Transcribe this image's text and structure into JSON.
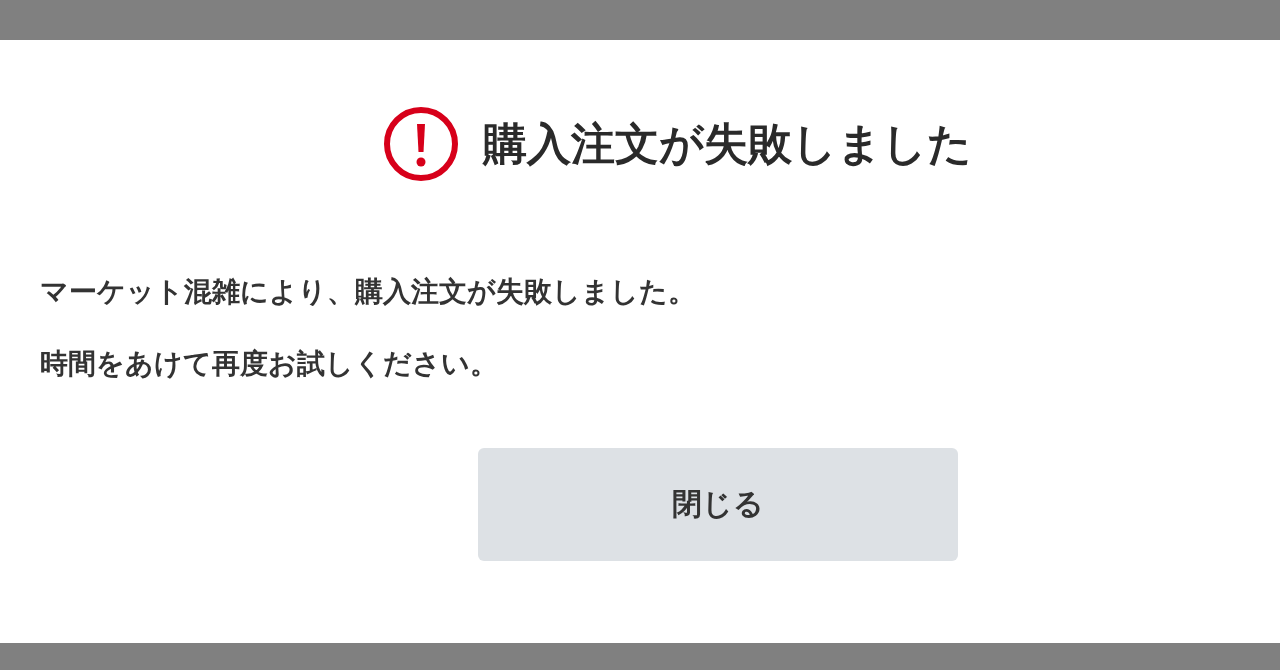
{
  "dialog": {
    "title": "購入注文が失敗しました",
    "messages": [
      "マーケット混雑により、購入注文が失敗しました。",
      "時間をあけて再度お試しください。"
    ],
    "button": {
      "label": "閉じる"
    }
  }
}
